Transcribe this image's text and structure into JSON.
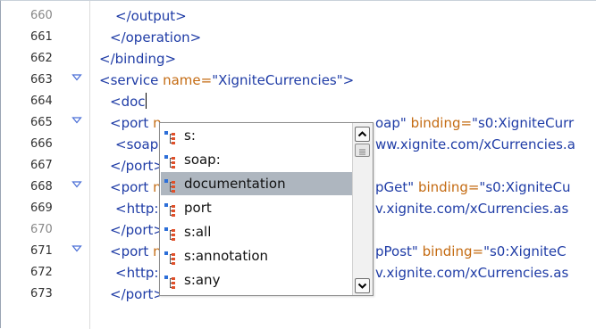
{
  "editor": {
    "lines": [
      {
        "num": "660",
        "grey": true,
        "fold": false,
        "indent": 2,
        "parts": [
          [
            "tag",
            "</output>"
          ]
        ]
      },
      {
        "num": "661",
        "grey": false,
        "fold": false,
        "indent": 1,
        "parts": [
          [
            "tag",
            "</operation>"
          ]
        ]
      },
      {
        "num": "662",
        "grey": false,
        "fold": false,
        "indent": 0,
        "parts": [
          [
            "tag",
            "</binding>"
          ]
        ]
      },
      {
        "num": "663",
        "grey": false,
        "fold": true,
        "indent": 0,
        "parts": [
          [
            "tag",
            "<service "
          ],
          [
            "attr",
            "name="
          ],
          [
            "val",
            "\"XigniteCurrencies\""
          ],
          [
            "tag",
            ">"
          ]
        ]
      },
      {
        "num": "664",
        "grey": false,
        "fold": false,
        "indent": 1,
        "parts": [
          [
            "tag",
            "<doc"
          ]
        ],
        "cursor": true
      },
      {
        "num": "665",
        "grey": false,
        "fold": true,
        "indent": 1,
        "parts": [
          [
            "tag",
            "<port "
          ],
          [
            "attr",
            "n"
          ],
          [
            "gap",
            ""
          ],
          [
            "val",
            "oap\" "
          ],
          [
            "attr",
            "binding="
          ],
          [
            "val",
            "\"s0:XigniteCurr"
          ]
        ]
      },
      {
        "num": "666",
        "grey": false,
        "fold": false,
        "indent": 2,
        "parts": [
          [
            "tag",
            "<soap"
          ],
          [
            "gap",
            ""
          ],
          [
            "val",
            "ww.xignite.com/xCurrencies.a"
          ]
        ]
      },
      {
        "num": "667",
        "grey": false,
        "fold": false,
        "indent": 1,
        "parts": [
          [
            "tag",
            "</port>"
          ]
        ]
      },
      {
        "num": "668",
        "grey": false,
        "fold": true,
        "indent": 1,
        "parts": [
          [
            "tag",
            "<port "
          ],
          [
            "attr",
            "n"
          ],
          [
            "gap",
            ""
          ],
          [
            "val",
            "pGet\" "
          ],
          [
            "attr",
            "binding="
          ],
          [
            "val",
            "\"s0:XigniteCu"
          ]
        ]
      },
      {
        "num": "669",
        "grey": false,
        "fold": false,
        "indent": 2,
        "parts": [
          [
            "tag",
            "<http:a"
          ],
          [
            "gap",
            ""
          ],
          [
            "val",
            "v.xignite.com/xCurrencies.as"
          ]
        ]
      },
      {
        "num": "670",
        "grey": true,
        "fold": false,
        "indent": 1,
        "parts": [
          [
            "tag",
            "</port>"
          ]
        ]
      },
      {
        "num": "671",
        "grey": false,
        "fold": true,
        "indent": 1,
        "parts": [
          [
            "tag",
            "<port "
          ],
          [
            "attr",
            "n"
          ],
          [
            "gap",
            ""
          ],
          [
            "val",
            "pPost\" "
          ],
          [
            "attr",
            "binding="
          ],
          [
            "val",
            "\"s0:XigniteC"
          ]
        ]
      },
      {
        "num": "672",
        "grey": false,
        "fold": false,
        "indent": 2,
        "parts": [
          [
            "tag",
            "<http:a"
          ],
          [
            "gap",
            ""
          ],
          [
            "val",
            "v.xignite.com/xCurrencies.as"
          ]
        ]
      },
      {
        "num": "673",
        "grey": false,
        "fold": false,
        "indent": 1,
        "parts": [
          [
            "tag",
            "</port>"
          ]
        ]
      }
    ]
  },
  "completion": {
    "items": [
      "s:",
      "soap:",
      "documentation",
      "port",
      "s:all",
      "s:annotation",
      "s:any"
    ],
    "selected_index": 2,
    "icon": "xml-element-icon",
    "scroll_up_icon": "chevron-up-icon",
    "scroll_down_icon": "chevron-down-icon"
  },
  "colors": {
    "tag": "#1f3ca6",
    "attribute": "#c46b12",
    "selection": "#aeb6bf"
  }
}
